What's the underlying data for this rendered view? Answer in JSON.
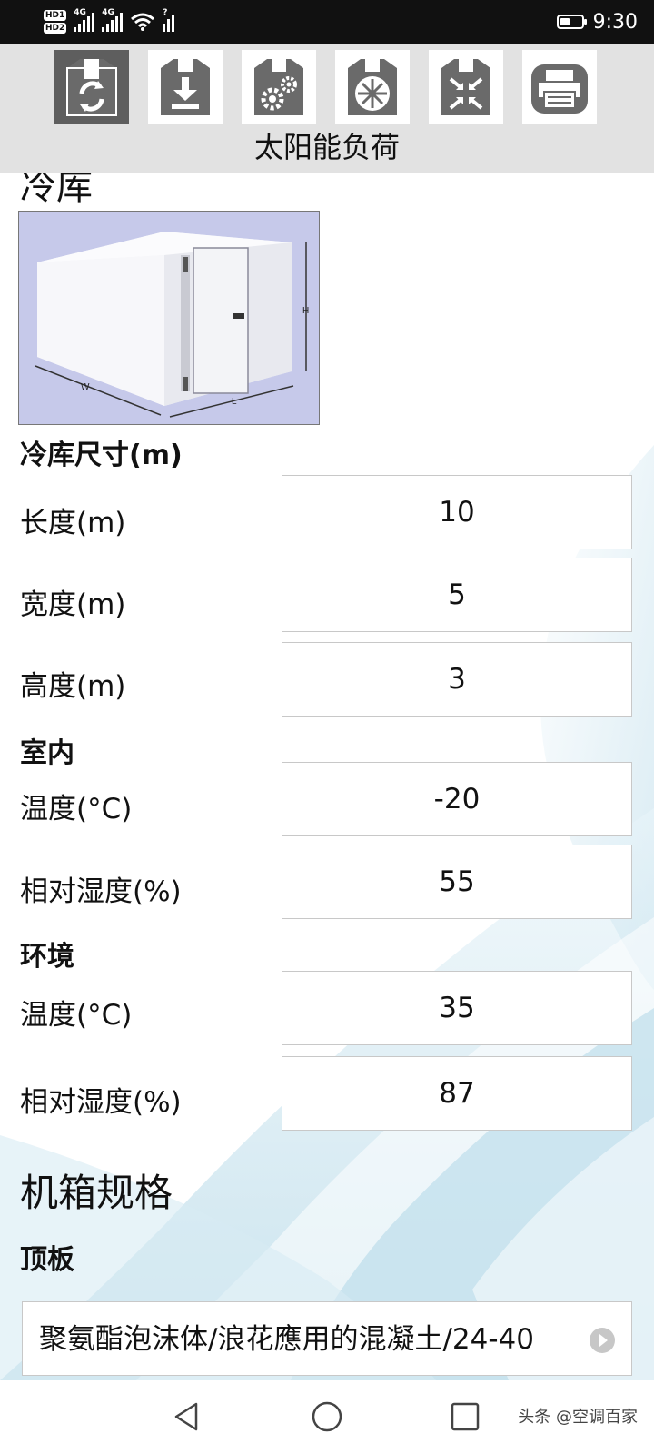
{
  "status_bar": {
    "hd1": "HD1",
    "hd2": "HD2",
    "net1": "4G",
    "net2": "4G",
    "sim_extra": "?",
    "time": "9:30",
    "battery_level": 0.45
  },
  "toolbar": {
    "title": "太阳能负荷",
    "buttons": [
      {
        "icon": "box-refresh-icon",
        "active": true
      },
      {
        "icon": "box-download-icon",
        "active": false
      },
      {
        "icon": "box-gears-icon",
        "active": false
      },
      {
        "icon": "box-fan-icon",
        "active": false
      },
      {
        "icon": "box-compress-icon",
        "active": false
      },
      {
        "icon": "printer-icon",
        "active": false
      }
    ]
  },
  "page": {
    "title": "冷库",
    "photo_labels": {
      "w": "W",
      "l": "L",
      "h": "H"
    }
  },
  "dimensions": {
    "section": "冷库尺寸(m)",
    "length_label": "长度(m)",
    "length_value": "10",
    "width_label": "宽度(m)",
    "width_value": "5",
    "height_label": "高度(m)",
    "height_value": "3"
  },
  "indoor": {
    "section": "室内",
    "temp_label": "温度(°C)",
    "temp_value": "-20",
    "rh_label": "相对湿度(%)",
    "rh_value": "55"
  },
  "ambient": {
    "section": "环境",
    "temp_label": "温度(°C)",
    "temp_value": "35",
    "rh_label": "相对湿度(%)",
    "rh_value": "87"
  },
  "cabinet": {
    "heading": "机箱规格",
    "top_label": "顶板",
    "top_value": "聚氨酯泡沫体/浪花應用的混凝土/24-40"
  },
  "nav": {
    "watermark": "头条 @空调百家"
  },
  "colors": {
    "toolbar_bg": "#e2e2e2",
    "active_button": "#5e5e5e",
    "icon_gray": "#6a6a6a",
    "wave_blue": "#bfe0ee"
  }
}
